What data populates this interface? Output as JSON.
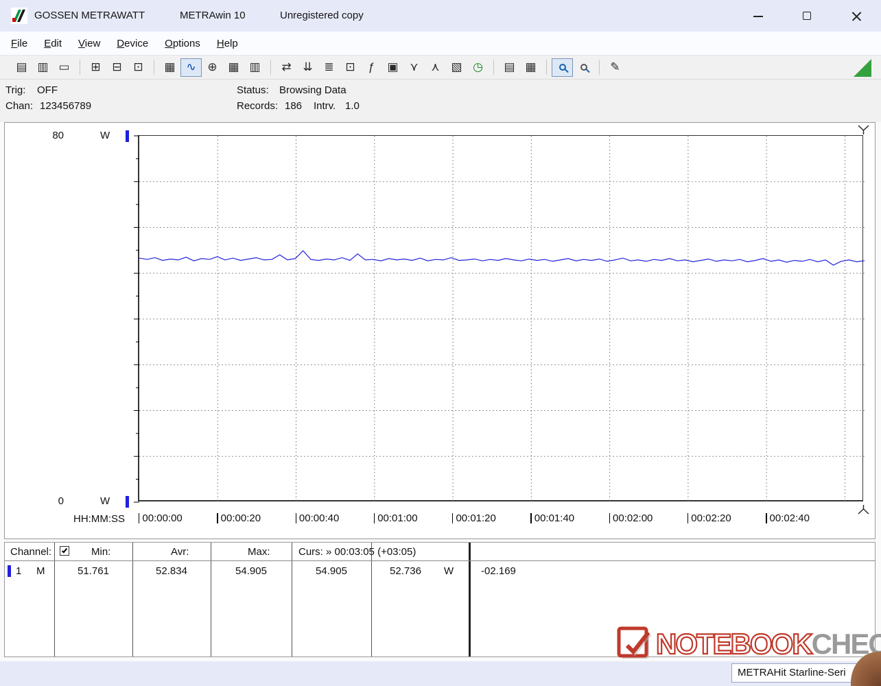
{
  "window": {
    "title_app": "GOSSEN METRAWATT",
    "title_product": "METRAwin 10",
    "title_status": "Unregistered copy"
  },
  "menu": {
    "items": [
      {
        "label": "File"
      },
      {
        "label": "Edit"
      },
      {
        "label": "View"
      },
      {
        "label": "Device"
      },
      {
        "label": "Options"
      },
      {
        "label": "Help"
      }
    ]
  },
  "toolbar": {
    "items": [
      {
        "name": "open-data-icon",
        "glyph": "▤"
      },
      {
        "name": "save-data-icon",
        "glyph": "▥"
      },
      {
        "name": "open-folder-icon",
        "glyph": "▭"
      },
      {
        "sep": true
      },
      {
        "name": "meter-display-icon",
        "glyph": "⊞"
      },
      {
        "name": "meter-read-icon",
        "glyph": "⊟"
      },
      {
        "name": "meter-store-icon",
        "glyph": "⊡"
      },
      {
        "sep": true
      },
      {
        "name": "numeric-view-icon",
        "glyph": "▦"
      },
      {
        "name": "trend-chart-icon",
        "glyph": "∿",
        "pressed": true,
        "color": "#0645ad"
      },
      {
        "name": "xy-chart-icon",
        "glyph": "⊕"
      },
      {
        "name": "table-view-icon",
        "glyph": "▦"
      },
      {
        "name": "histogram-view-icon",
        "glyph": "▥"
      },
      {
        "sep": true
      },
      {
        "name": "device-transfer-icon",
        "glyph": "⇄"
      },
      {
        "name": "device-download-icon",
        "glyph": "⇊"
      },
      {
        "name": "channel-setup-icon",
        "glyph": "≣"
      },
      {
        "name": "monitor-icon",
        "glyph": "⊡"
      },
      {
        "name": "formula-icon",
        "glyph": "ƒ"
      },
      {
        "name": "memory-icon",
        "glyph": "▣"
      },
      {
        "name": "channel-split-icon",
        "glyph": "⋎"
      },
      {
        "name": "channel-merge-icon",
        "glyph": "⋏"
      },
      {
        "name": "clipboard-copy-icon",
        "glyph": "▧"
      },
      {
        "name": "timer-icon",
        "glyph": "◷",
        "color": "#128a12"
      },
      {
        "sep": true
      },
      {
        "name": "print-preview-icon",
        "glyph": "▤"
      },
      {
        "name": "print-icon",
        "glyph": "▦"
      },
      {
        "sep": true
      },
      {
        "name": "zoom-mode-icon",
        "shape": "magnifier",
        "pressed": true,
        "color": "#1560b0"
      },
      {
        "name": "zoom-out-icon",
        "shape": "magnifier",
        "color": "#555555"
      },
      {
        "sep": true
      },
      {
        "name": "annotation-icon",
        "glyph": "✎"
      }
    ]
  },
  "status_panel": {
    "trig_label": "Trig:",
    "trig_value": "OFF",
    "chan_label": "Chan:",
    "chan_value": "123456789",
    "status_label": "Status:",
    "status_value": "Browsing Data",
    "records_label": "Records:",
    "records_value": "186",
    "intrv_label": "Intrv.",
    "intrv_value": "1.0"
  },
  "chart_data": {
    "type": "line",
    "title": "",
    "ylabel": "W",
    "y_top_label": "80",
    "y_bottom_label": "0",
    "y_unit": "W",
    "ylim": [
      0,
      80
    ],
    "y_gridline_step": 10,
    "x_axis_label": "HH:MM:SS",
    "x_ticks": [
      "00:00:00",
      "00:00:20",
      "00:00:40",
      "00:01:00",
      "00:01:20",
      "00:01:40",
      "00:02:00",
      "00:02:20",
      "00:02:40"
    ],
    "x_tick_seconds": [
      0,
      20,
      40,
      60,
      80,
      100,
      120,
      140,
      160
    ],
    "x_gridline_step_seconds": 20,
    "x_range_seconds": [
      0,
      185
    ],
    "grid": "dashed",
    "legend": "none",
    "line_color": "#2323dd",
    "series": [
      {
        "name": "Channel 1 (M)",
        "unit": "W",
        "values": [
          53.3,
          53.0,
          53.4,
          52.8,
          53.1,
          52.9,
          53.5,
          52.7,
          53.2,
          53.0,
          53.6,
          52.9,
          53.3,
          52.8,
          53.1,
          53.4,
          52.9,
          53.0,
          54.0,
          52.9,
          53.2,
          54.905,
          53.0,
          52.8,
          53.1,
          52.9,
          53.4,
          52.8,
          54.2,
          52.9,
          53.0,
          52.7,
          53.2,
          52.9,
          53.1,
          52.8,
          53.3,
          52.7,
          53.0,
          52.9,
          53.4,
          52.8,
          52.9,
          53.1,
          52.7,
          53.0,
          52.8,
          53.2,
          52.9,
          52.7,
          53.1,
          52.8,
          53.0,
          52.6,
          52.9,
          53.2,
          52.7,
          53.0,
          52.8,
          53.1,
          52.6,
          52.9,
          53.3,
          52.7,
          52.9,
          52.6,
          53.0,
          52.8,
          53.2,
          52.7,
          52.9,
          52.5,
          52.8,
          53.1,
          52.6,
          52.9,
          52.7,
          53.0,
          52.5,
          52.8,
          53.2,
          52.6,
          52.9,
          52.4,
          52.8,
          52.6,
          53.0,
          52.5,
          52.9,
          51.761,
          52.6,
          52.9,
          52.5,
          52.736
        ]
      }
    ],
    "cursor": {
      "position": "00:03:05",
      "offset": "(+03:05)",
      "value_a": 54.905,
      "value_b": 52.736,
      "delta": -2.169
    }
  },
  "table": {
    "channel_label": "Channel:",
    "min_label": "Min:",
    "avr_label": "Avr:",
    "max_label": "Max:",
    "curs_label": "Curs: » 00:03:05 (+03:05)",
    "row": {
      "channel": "1",
      "mode": "M",
      "min": "51.761",
      "avr": "52.834",
      "max": "54.905",
      "cursor_a": "54.905",
      "cursor_b": "52.736",
      "unit": "W",
      "delta": "-02.169"
    }
  },
  "watermark": {
    "part1": "NOTEBOOK",
    "part2": "CHECK"
  },
  "statusbar": {
    "device": "METRAHit Starline-Seri"
  }
}
